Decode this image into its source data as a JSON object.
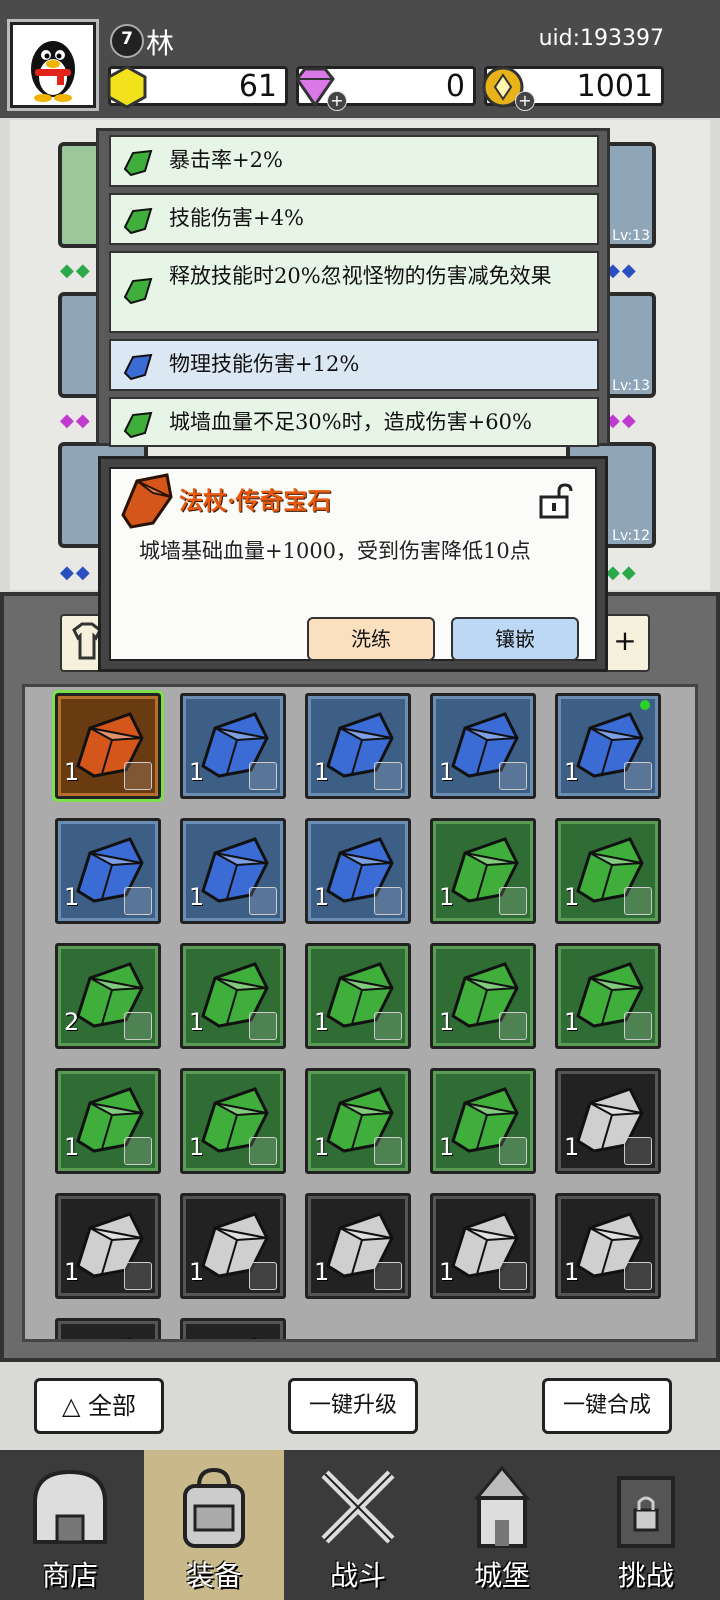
{
  "player": {
    "level": "7",
    "name": "林",
    "uid": "uid:193397"
  },
  "resources": {
    "gold_gem": "61",
    "diamond": "0",
    "coin": "1001"
  },
  "attributes": [
    {
      "text": "暴击率+2%",
      "color": "green"
    },
    {
      "text": "技能伤害+4%",
      "color": "green"
    },
    {
      "text": "释放技能时20%忽视怪物的伤害减免效果",
      "color": "green"
    },
    {
      "text": "物理技能伤害+12%",
      "color": "blue"
    },
    {
      "text": "城墙血量不足30%时，造成伤害+60%",
      "color": "green"
    }
  ],
  "slot_levels": [
    "Lv:13",
    "Lv:13",
    "Lv:12"
  ],
  "popup": {
    "title": "法杖·传奇宝石",
    "description": "城墙基础血量+1000，受到伤害降低10点",
    "reroll_label": "洗练",
    "inlay_label": "镶嵌"
  },
  "inventory": [
    {
      "rarity": "orange",
      "count": "1",
      "type": "staff-icon",
      "selected": true
    },
    {
      "rarity": "blue",
      "count": "1",
      "type": "ring-icon"
    },
    {
      "rarity": "blue",
      "count": "1",
      "type": "ring-icon"
    },
    {
      "rarity": "blue",
      "count": "1",
      "type": "armor-icon"
    },
    {
      "rarity": "blue",
      "count": "1",
      "type": "armor-icon",
      "new": true
    },
    {
      "rarity": "blue",
      "count": "1",
      "type": "staff-icon"
    },
    {
      "rarity": "blue",
      "count": "1",
      "type": "staff-icon"
    },
    {
      "rarity": "blue",
      "count": "1",
      "type": "helmet-icon"
    },
    {
      "rarity": "green",
      "count": "1",
      "type": "ring-icon"
    },
    {
      "rarity": "green",
      "count": "1",
      "type": "ring-icon"
    },
    {
      "rarity": "green",
      "count": "2",
      "type": "ring-icon"
    },
    {
      "rarity": "green",
      "count": "1",
      "type": "boots-icon"
    },
    {
      "rarity": "green",
      "count": "1",
      "type": "boots-icon"
    },
    {
      "rarity": "green",
      "count": "1",
      "type": "helmet-icon"
    },
    {
      "rarity": "green",
      "count": "1",
      "type": "helmet-icon"
    },
    {
      "rarity": "green",
      "count": "1",
      "type": "necklace-icon"
    },
    {
      "rarity": "green",
      "count": "1",
      "type": "necklace-icon"
    },
    {
      "rarity": "green",
      "count": "1",
      "type": "necklace-icon"
    },
    {
      "rarity": "green",
      "count": "1",
      "type": "necklace-icon"
    },
    {
      "rarity": "grey",
      "count": "1",
      "type": "ring-icon"
    },
    {
      "rarity": "grey",
      "count": "1",
      "type": "ring-icon"
    },
    {
      "rarity": "grey",
      "count": "1",
      "type": "ring-icon"
    },
    {
      "rarity": "grey",
      "count": "1",
      "type": "armor-icon"
    },
    {
      "rarity": "grey",
      "count": "1",
      "type": "armor-icon"
    },
    {
      "rarity": "grey",
      "count": "1",
      "type": "staff-icon"
    },
    {
      "rarity": "grey",
      "count": "",
      "type": ""
    },
    {
      "rarity": "grey",
      "count": "",
      "type": ""
    }
  ],
  "actions": {
    "filter_label": "全部",
    "upgrade_all_label": "一键升级",
    "merge_all_label": "一键合成"
  },
  "nav": [
    {
      "label": "商店",
      "active": false
    },
    {
      "label": "装备",
      "active": true
    },
    {
      "label": "战斗",
      "active": false
    },
    {
      "label": "城堡",
      "active": false
    },
    {
      "label": "挑战",
      "active": false
    }
  ],
  "colors": {
    "green_gem": "#3fae3a",
    "blue_gem": "#3b6cd6",
    "orange_gem": "#d5561a",
    "grey_gem": "#cfcfcf",
    "title_orange": "#e85a10"
  }
}
